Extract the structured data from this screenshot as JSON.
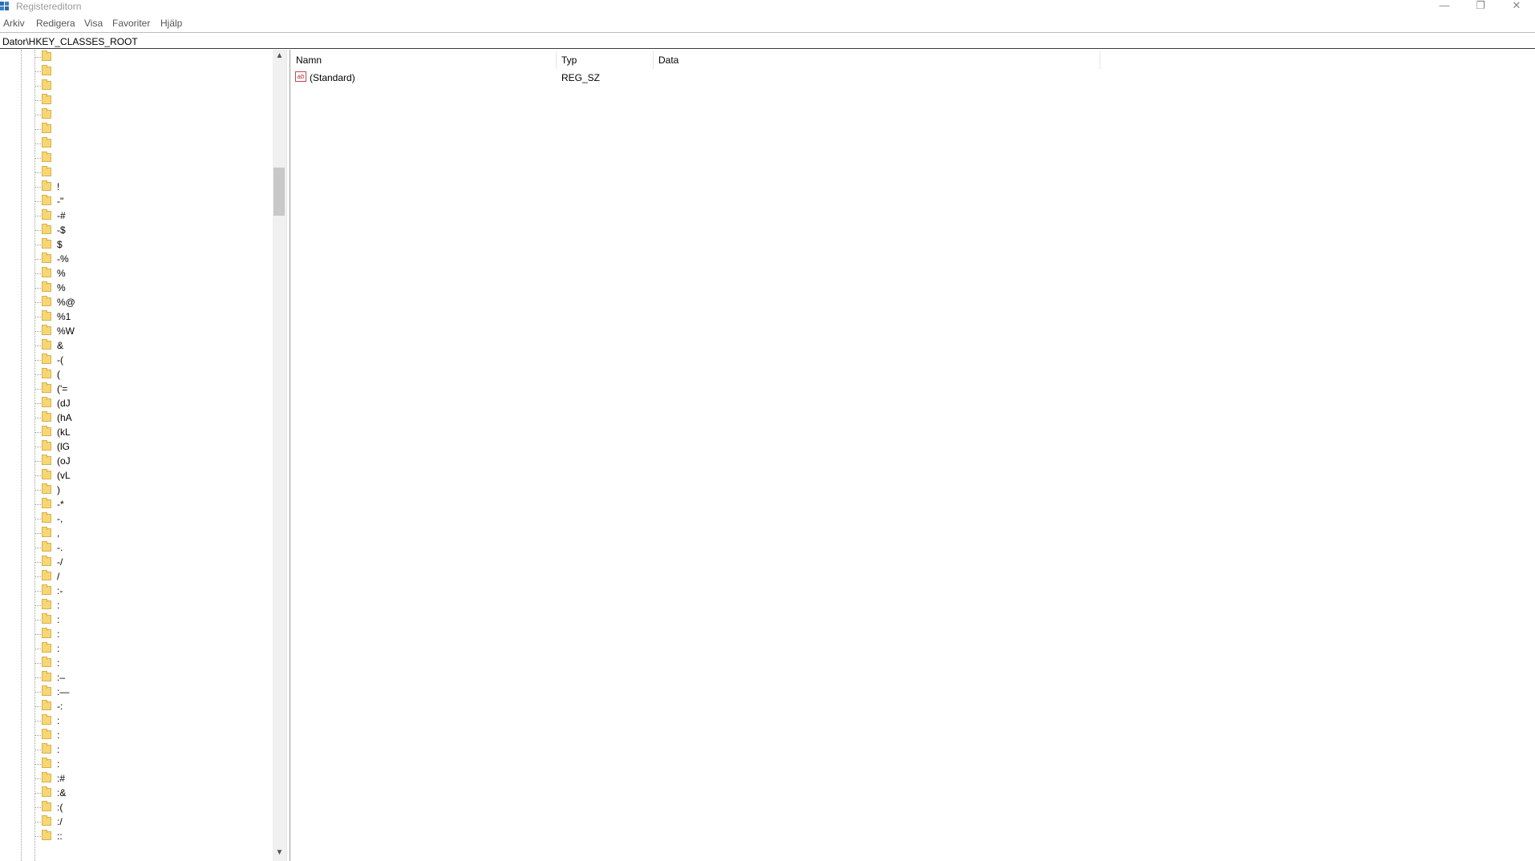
{
  "window": {
    "title": "Registereditorn",
    "minimize_glyph": "—",
    "maximize_glyph": "❐",
    "close_glyph": "✕"
  },
  "menu": {
    "items": [
      "Arkiv",
      "Redigera",
      "Visa",
      "Favoriter",
      "Hjälp"
    ]
  },
  "address": {
    "path": "Dator\\HKEY_CLASSES_ROOT"
  },
  "tree": {
    "items": [
      "",
      "",
      "",
      "",
      "",
      "",
      "",
      "",
      "",
      "!",
      "-\"",
      "-#",
      "-$",
      "$",
      "-%",
      "%",
      "%",
      "%@",
      "%1",
      "%W",
      "&",
      "-(",
      "(",
      "('=",
      "(dJ",
      "(hA",
      "(kL",
      "(lG",
      "(oJ",
      "(vL",
      ")",
      "-*",
      "-,",
      ",",
      "-.",
      "-/",
      "/",
      ":-",
      ":",
      ":",
      ":",
      ":",
      ":",
      ":–",
      ":—",
      "-:",
      ":",
      ":",
      ":",
      ":",
      ":#",
      ":&",
      ":(",
      ":/",
      "::"
    ]
  },
  "scroll": {
    "up_glyph": "▲",
    "down_glyph": "▼"
  },
  "values": {
    "columns": [
      "Namn",
      "Typ",
      "Data"
    ],
    "rows": [
      {
        "icon": "string-value-icon",
        "icon_text": "ab",
        "name": "(Standard)",
        "type": "REG_SZ",
        "data": ""
      }
    ]
  },
  "colors": {
    "folder": "#f7d774",
    "folder_border": "#d7b14a",
    "string_icon": "#b83232"
  }
}
